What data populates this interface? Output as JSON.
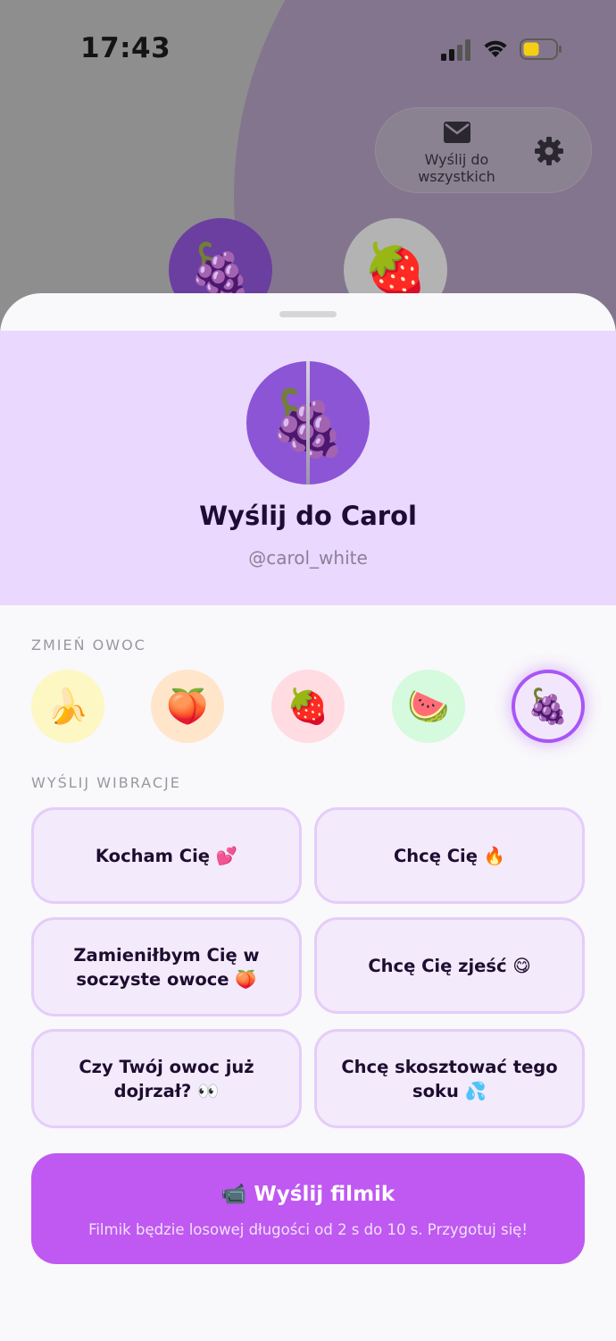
{
  "status_bar": {
    "time": "17:43"
  },
  "top_actions": {
    "send_all_label": "Wyślij do\nwszystkich"
  },
  "background_friends": [
    {
      "icon": "grapes"
    },
    {
      "icon": "strawberry"
    }
  ],
  "sheet": {
    "title": "Wyślij do Carol",
    "handle": "@carol_white",
    "change_fruit_label": "ZMIEŃ OWOC",
    "fruits": [
      {
        "icon": "banana",
        "emoji": "🍌",
        "bg": "#fdf7c3",
        "selected": false
      },
      {
        "icon": "peach",
        "emoji": "🍑",
        "bg": "#ffe6cb",
        "selected": false
      },
      {
        "icon": "strawberry",
        "emoji": "🍓",
        "bg": "#ffdbe2",
        "selected": false
      },
      {
        "icon": "watermelon",
        "emoji": "🍉",
        "bg": "#d5fadd",
        "selected": false
      },
      {
        "icon": "grapes",
        "emoji": "🍇",
        "bg": "#f2e6fc",
        "selected": true
      }
    ],
    "send_vibe_label": "WYŚLIJ WIBRACJE",
    "vibes": [
      "Kocham Cię 💕",
      "Chcę Cię 🔥",
      "Zamieniłbym Cię w soczyste owoce 🍑",
      "Chcę Cię zjeść 😋",
      "Czy Twój owoc już dojrzał? 👀",
      "Chcę skosztować tego soku 💦"
    ],
    "video_button": {
      "label": "📹 Wyślij filmik",
      "note": "Filmik będzie losowej długości od 2 s do 10 s. Przygotuj się!"
    }
  },
  "colors": {
    "accent": "#a855f7",
    "button": "#bf59f1",
    "header_bg": "#ead8fe",
    "vibe_bg": "#f3eafb"
  }
}
